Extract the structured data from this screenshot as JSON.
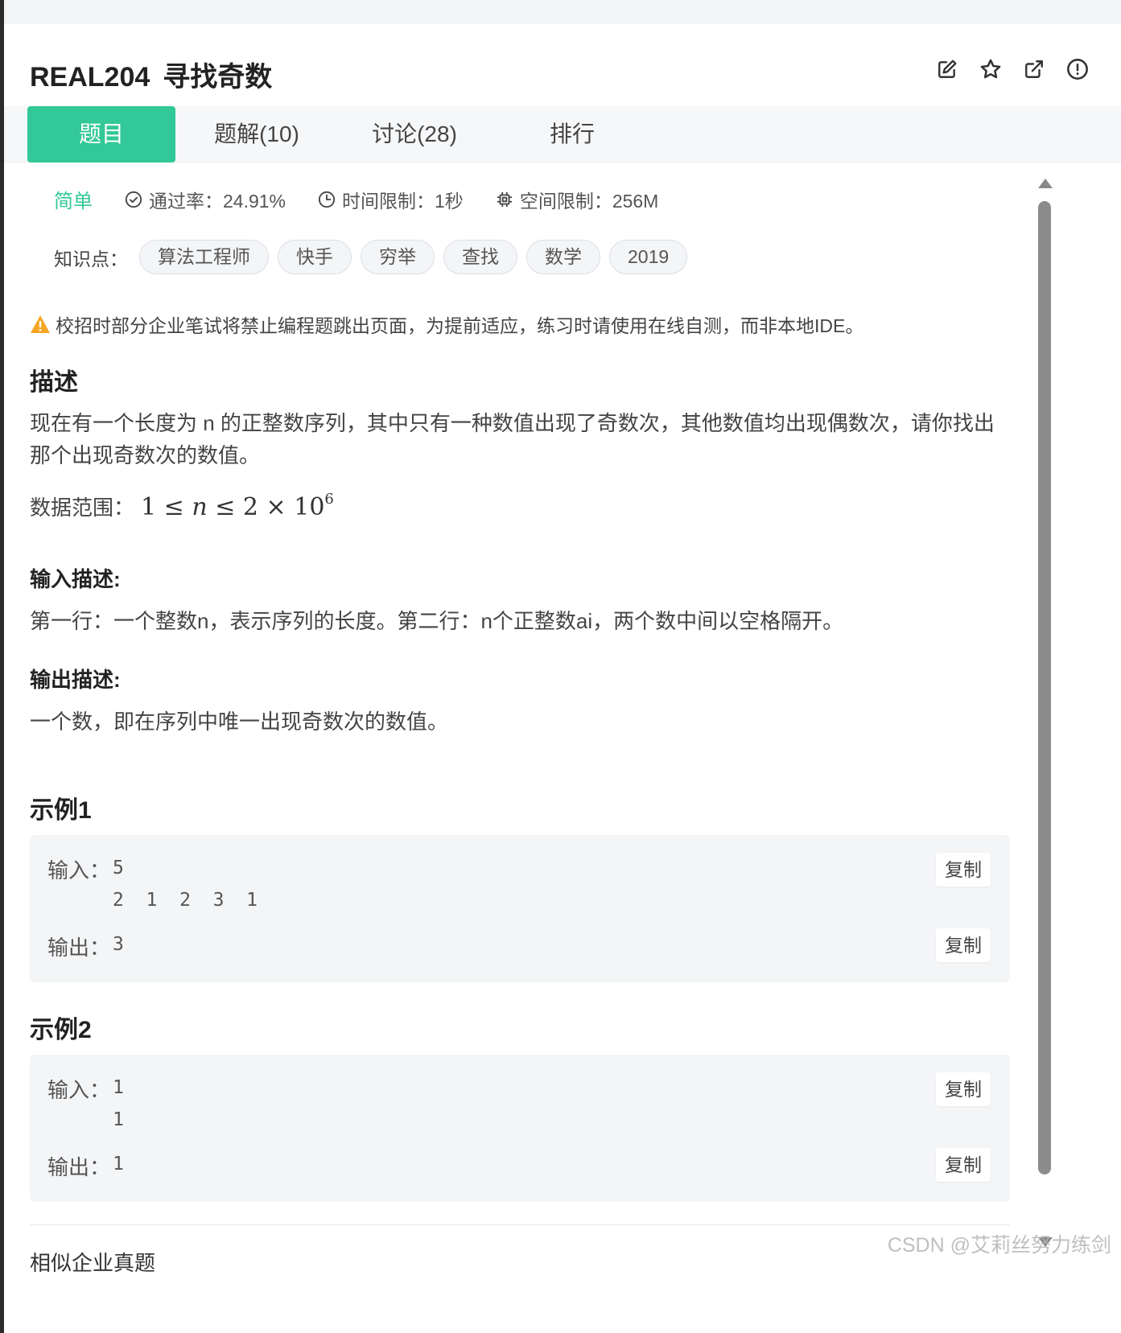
{
  "header": {
    "problem_id": "REAL204",
    "problem_name": "寻找奇数"
  },
  "header_icons": [
    "edit-icon",
    "star-icon",
    "share-icon",
    "report-icon"
  ],
  "tabs": [
    {
      "label": "题目",
      "active": true
    },
    {
      "label": "题解(10)",
      "active": false
    },
    {
      "label": "讨论(28)",
      "active": false
    },
    {
      "label": "排行",
      "active": false
    }
  ],
  "meta": {
    "difficulty": "简单",
    "pass_rate": "通过率：24.91%",
    "time_limit": "时间限制：1秒",
    "memory_limit": "空间限制：256M"
  },
  "knowledge": {
    "label": "知识点：",
    "tags": [
      "算法工程师",
      "快手",
      "穷举",
      "查找",
      "数学",
      "2019"
    ]
  },
  "notice": "校招时部分企业笔试将禁止编程题跳出页面，为提前适应，练习时请使用在线自测，而非本地IDE。",
  "description": {
    "heading": "描述",
    "text": "现在有一个长度为 n 的正整数序列，其中只有一种数值出现了奇数次，其他数值均出现偶数次，请你找出那个出现奇数次的数值。",
    "range_label": "数据范围：",
    "range_formula": {
      "one": "1",
      "le1": "≤",
      "n": "n",
      "le2": "≤",
      "two": "2",
      "times": "×",
      "ten": "10",
      "exp": "6"
    }
  },
  "input_desc": {
    "heading": "输入描述:",
    "text": "第一行：一个整数n，表示序列的长度。第二行：n个正整数ai，两个数中间以空格隔开。"
  },
  "output_desc": {
    "heading": "输出描述:",
    "text": "一个数，即在序列中唯一出现奇数次的数值。"
  },
  "examples": [
    {
      "heading": "示例1",
      "input_label": "输入：",
      "input": "5\n2 1 2 3 1",
      "output_label": "输出：",
      "output": "3",
      "copy": "复制"
    },
    {
      "heading": "示例2",
      "input_label": "输入：",
      "input": "1\n1",
      "output_label": "输出：",
      "output": "1",
      "copy": "复制"
    }
  ],
  "more_heading": "相似企业真题",
  "watermark": "CSDN @艾莉丝努力练剑",
  "colors": {
    "accent": "#32c897",
    "warning": "#f5a623"
  }
}
